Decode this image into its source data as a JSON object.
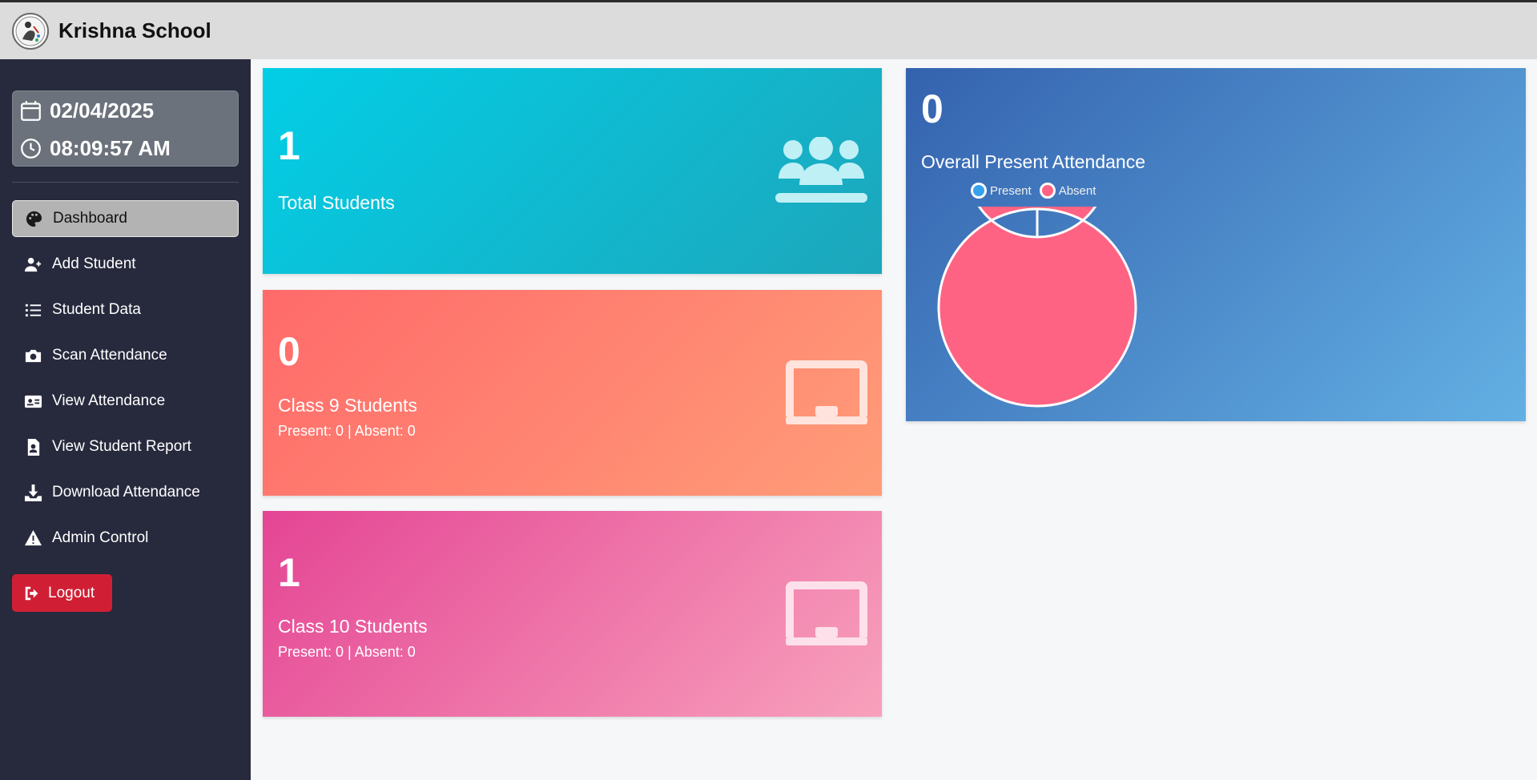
{
  "header": {
    "title": "Krishna School"
  },
  "clock": {
    "date": "02/04/2025",
    "time": "08:09:57 AM"
  },
  "sidebar": {
    "items": [
      {
        "label": "Dashboard",
        "icon": "palette-icon",
        "active": true
      },
      {
        "label": "Add Student",
        "icon": "user-plus-icon"
      },
      {
        "label": "Student Data",
        "icon": "list-icon"
      },
      {
        "label": "Scan Attendance",
        "icon": "camera-icon"
      },
      {
        "label": "View Attendance",
        "icon": "id-card-icon"
      },
      {
        "label": "View Student Report",
        "icon": "file-person-icon"
      },
      {
        "label": "Download Attendance",
        "icon": "download-icon"
      },
      {
        "label": "Admin Control",
        "icon": "warning-icon"
      }
    ],
    "logout_label": "Logout"
  },
  "cards": {
    "total": {
      "value": "1",
      "label": "Total Students",
      "icon": "users-icon"
    },
    "class9": {
      "value": "0",
      "label": "Class 9 Students",
      "sub": "Present: 0 | Absent: 0",
      "icon": "chalkboard-icon"
    },
    "class10": {
      "value": "1",
      "label": "Class 10 Students",
      "sub": "Present: 0 | Absent: 0",
      "icon": "chalkboard-icon"
    }
  },
  "attendance": {
    "value": "0",
    "label": "Overall Present Attendance",
    "legend": [
      {
        "label": "Present",
        "color": "#36a2eb"
      },
      {
        "label": "Absent",
        "color": "#ff6384"
      }
    ]
  },
  "chart_data": {
    "type": "pie",
    "categories": [
      "Present",
      "Absent"
    ],
    "values": [
      0,
      1
    ],
    "colors": [
      "#36a2eb",
      "#ff6384"
    ],
    "legend": "top"
  }
}
